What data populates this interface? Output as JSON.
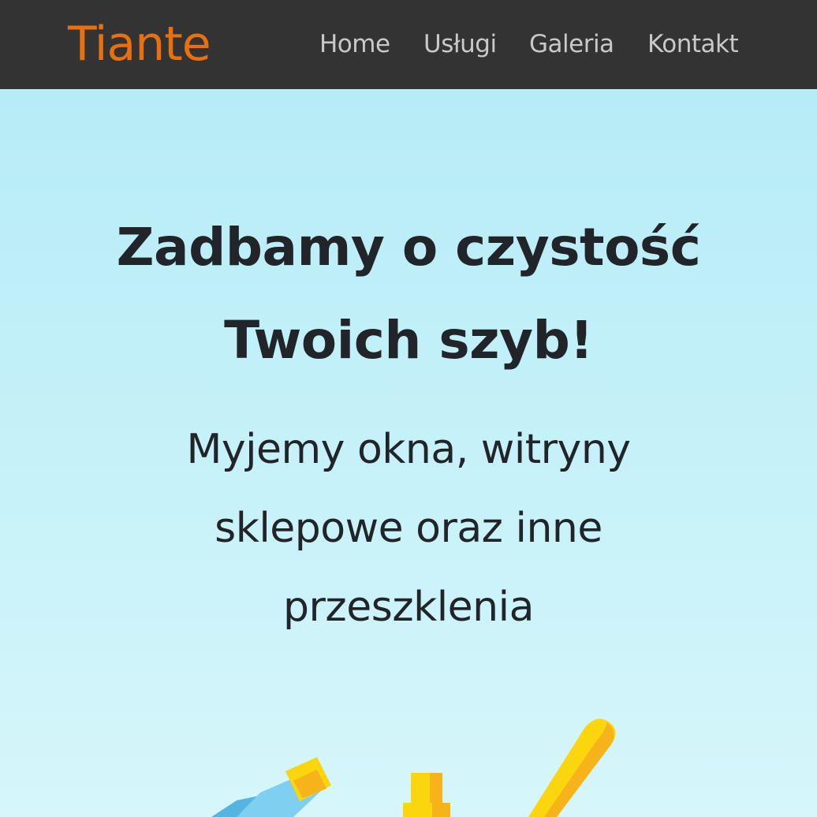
{
  "nav": {
    "brand": "Tiante",
    "links": [
      "Home",
      "Usługi",
      "Galeria",
      "Kontakt"
    ]
  },
  "hero": {
    "title_line1": "Zadbamy o czystość",
    "title_line2": "Twoich szyb!",
    "subtitle_line1": "Myjemy okna, witryny",
    "subtitle_line2": "sklepowe oraz inne",
    "subtitle_line3": "przeszklenia"
  },
  "colors": {
    "navbar_bg": "#333333",
    "brand": "#e8710f",
    "nav_link": "#c9c9c9",
    "heading_text": "#212529",
    "hero_bg_top": "#b3ebf6",
    "hero_bg_bottom": "#d6f6fb",
    "accent_yellow": "#fbd50d",
    "accent_blue": "#7ecff0"
  },
  "icons": [
    "spray-bottle-icon",
    "squeegee-handle-icon"
  ]
}
